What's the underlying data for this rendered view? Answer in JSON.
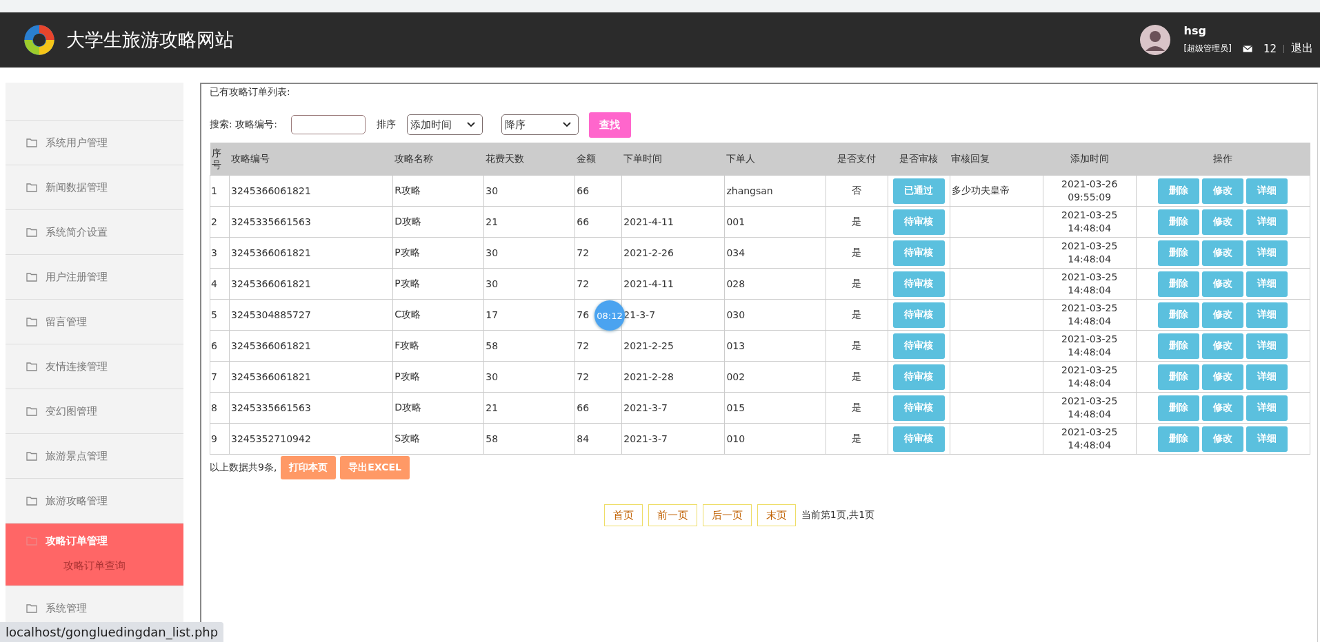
{
  "header": {
    "site_title": "大学生旅游攻略网站",
    "user": {
      "name": "hsg",
      "role": "[超级管理员]"
    },
    "messages": "12",
    "logout": "退出"
  },
  "sidebar": {
    "items": [
      {
        "label": "系统用户管理",
        "selected": false
      },
      {
        "label": "新闻数据管理",
        "selected": false
      },
      {
        "label": "系统简介设置",
        "selected": false
      },
      {
        "label": "用户注册管理",
        "selected": false
      },
      {
        "label": "留言管理",
        "selected": false
      },
      {
        "label": "友情连接管理",
        "selected": false
      },
      {
        "label": "变幻图管理",
        "selected": false
      },
      {
        "label": "旅游景点管理",
        "selected": false
      },
      {
        "label": "旅游攻略管理",
        "selected": false
      },
      {
        "label": "攻略订单管理",
        "selected": true,
        "children": [
          {
            "label": "攻略订单查询"
          }
        ]
      },
      {
        "label": "系统管理",
        "selected": false
      }
    ]
  },
  "page_title": "已有攻略订单列表:",
  "search": {
    "label": "搜索: 攻略编号:",
    "sort_label": "排序",
    "sort_field": "添加时间",
    "sort_order": "降序",
    "button": "查找"
  },
  "table": {
    "columns": [
      "序号",
      "攻略编号",
      "攻略名称",
      "花费天数",
      "金额",
      "下单时间",
      "下单人",
      "是否支付",
      "是否审核",
      "审核回复",
      "添加时间",
      "操作"
    ],
    "rows": [
      {
        "no": "1",
        "code": "3245366061821",
        "name": "R攻略",
        "days": "30",
        "amount": "66",
        "order_time": "",
        "orderer": "zhangsan",
        "paid": "否",
        "review": "已通过",
        "reply": "多少功夫皇帝",
        "added": [
          "2021-03-26",
          "09:55:09"
        ],
        "actions": [
          "删除",
          "修改",
          "详细"
        ]
      },
      {
        "no": "2",
        "code": "3245335661563",
        "name": "D攻略",
        "days": "21",
        "amount": "66",
        "order_time": "2021-4-11",
        "orderer": "001",
        "paid": "是",
        "review": "待审核",
        "reply": "",
        "added": [
          "2021-03-25",
          "14:48:04"
        ],
        "actions": [
          "删除",
          "修改",
          "详细"
        ]
      },
      {
        "no": "3",
        "code": "3245366061821",
        "name": "P攻略",
        "days": "30",
        "amount": "72",
        "order_time": "2021-2-26",
        "orderer": "034",
        "paid": "是",
        "review": "待审核",
        "reply": "",
        "added": [
          "2021-03-25",
          "14:48:04"
        ],
        "actions": [
          "删除",
          "修改",
          "详细"
        ]
      },
      {
        "no": "4",
        "code": "3245366061821",
        "name": "P攻略",
        "days": "30",
        "amount": "72",
        "order_time": "2021-4-11",
        "orderer": "028",
        "paid": "是",
        "review": "待审核",
        "reply": "",
        "added": [
          "2021-03-25",
          "14:48:04"
        ],
        "actions": [
          "删除",
          "修改",
          "详细"
        ]
      },
      {
        "no": "5",
        "code": "3245304885727",
        "name": "C攻略",
        "days": "17",
        "amount": "76",
        "order_time": "21-3-7",
        "orderer": "030",
        "paid": "是",
        "review": "待审核",
        "reply": "",
        "added": [
          "2021-03-25",
          "14:48:04"
        ],
        "actions": [
          "删除",
          "修改",
          "详细"
        ]
      },
      {
        "no": "6",
        "code": "3245366061821",
        "name": "F攻略",
        "days": "58",
        "amount": "72",
        "order_time": "2021-2-25",
        "orderer": "013",
        "paid": "是",
        "review": "待审核",
        "reply": "",
        "added": [
          "2021-03-25",
          "14:48:04"
        ],
        "actions": [
          "删除",
          "修改",
          "详细"
        ]
      },
      {
        "no": "7",
        "code": "3245366061821",
        "name": "P攻略",
        "days": "30",
        "amount": "72",
        "order_time": "2021-2-28",
        "orderer": "002",
        "paid": "是",
        "review": "待审核",
        "reply": "",
        "added": [
          "2021-03-25",
          "14:48:04"
        ],
        "actions": [
          "删除",
          "修改",
          "详细"
        ]
      },
      {
        "no": "8",
        "code": "3245335661563",
        "name": "D攻略",
        "days": "21",
        "amount": "66",
        "order_time": "2021-3-7",
        "orderer": "015",
        "paid": "是",
        "review": "待审核",
        "reply": "",
        "added": [
          "2021-03-25",
          "14:48:04"
        ],
        "actions": [
          "删除",
          "修改",
          "详细"
        ]
      },
      {
        "no": "9",
        "code": "3245352710942",
        "name": "S攻略",
        "days": "58",
        "amount": "84",
        "order_time": "2021-3-7",
        "orderer": "010",
        "paid": "是",
        "review": "待审核",
        "reply": "",
        "added": [
          "2021-03-25",
          "14:48:04"
        ],
        "actions": [
          "删除",
          "修改",
          "详细"
        ]
      }
    ]
  },
  "summary": {
    "text": "以上数据共9条,",
    "buttons": [
      "打印本页",
      "导出EXCEL"
    ]
  },
  "pagination": {
    "buttons": [
      "首页",
      "前一页",
      "后一页",
      "末页"
    ],
    "info": "当前第1页,共1页"
  },
  "timer_badge": "08:12",
  "status_url": "localhost/gongluedingdan_list.php"
}
